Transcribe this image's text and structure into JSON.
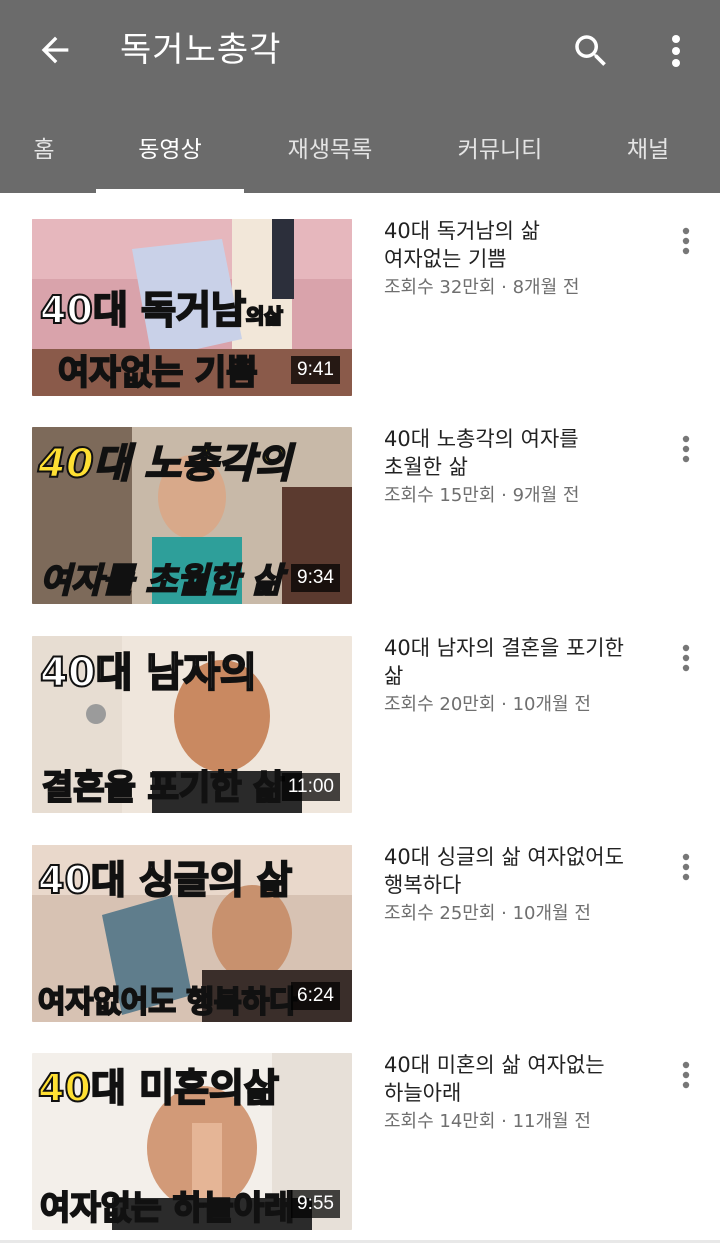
{
  "header": {
    "title": "독거노총각",
    "back_icon": "arrow-back-icon",
    "search_icon": "search-icon",
    "more_icon": "more-vert-icon",
    "background": "#6b6b6b"
  },
  "tabs": [
    {
      "label": "홈",
      "active": false
    },
    {
      "label": "동영상",
      "active": true
    },
    {
      "label": "재생목록",
      "active": false
    },
    {
      "label": "커뮤니티",
      "active": false
    },
    {
      "label": "채널",
      "active": false
    }
  ],
  "videos": [
    {
      "title": "40대 독거남의 삶\n여자없는 기쁨",
      "stats": "조회수 32만회 · 8개월 전",
      "duration": "9:41",
      "thumb_top": "40대 독거남",
      "thumb_top_suffix": "의삶",
      "thumb_bottom": "여자없는 기쁨"
    },
    {
      "title": "40대 노총각의 여자를\n초월한 삶",
      "stats": "조회수 15만회 · 9개월 전",
      "duration": "9:34",
      "thumb_top": "40대 노총각의",
      "thumb_top_suffix": "",
      "thumb_bottom": "여자를 초월한 삶"
    },
    {
      "title": "40대 남자의 결혼을 포기한\n삶",
      "stats": "조회수 20만회 · 10개월 전",
      "duration": "11:00",
      "thumb_top": "40대 남자의",
      "thumb_top_suffix": "",
      "thumb_bottom": "결혼을 포기한 삶"
    },
    {
      "title": "40대 싱글의 삶 여자없어도\n행복하다",
      "stats": "조회수 25만회 · 10개월 전",
      "duration": "6:24",
      "thumb_top": "40대 싱글의 삶",
      "thumb_top_suffix": "",
      "thumb_bottom": "여자없어도 행복하다"
    },
    {
      "title": "40대 미혼의 삶 여자없는\n하늘아래",
      "stats": "조회수 14만회 · 11개월 전",
      "duration": "9:55",
      "thumb_top": "40대 미혼의",
      "thumb_top_suffix": "삶",
      "thumb_bottom": "여자없는 하늘아래"
    }
  ]
}
